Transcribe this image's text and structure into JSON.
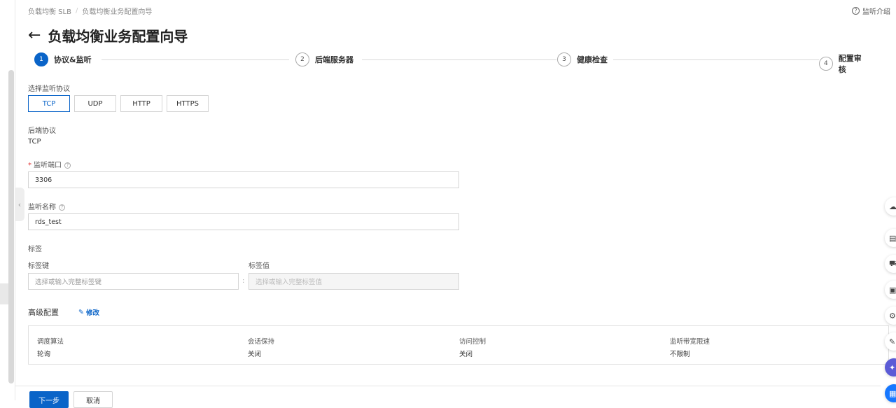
{
  "breadcrumb": {
    "root": "负载均衡 SLB",
    "separator": "/",
    "current": "负载均衡业务配置向导"
  },
  "help": {
    "label": "监听介绍"
  },
  "title": "负载均衡业务配置向导",
  "steps": [
    {
      "num": "1",
      "label": "协议&监听",
      "active": true
    },
    {
      "num": "2",
      "label": "后端服务器",
      "active": false
    },
    {
      "num": "3",
      "label": "健康检查",
      "active": false
    },
    {
      "num": "4",
      "label": "配置审核",
      "active": false
    }
  ],
  "protocol": {
    "label": "选择监听协议",
    "options": [
      "TCP",
      "UDP",
      "HTTP",
      "HTTPS"
    ],
    "selected": "TCP"
  },
  "backend_protocol": {
    "label": "后端协议",
    "value": "TCP"
  },
  "listen_port": {
    "label": "监听端口",
    "value": "3306"
  },
  "listen_name": {
    "label": "监听名称",
    "value": "rds_test"
  },
  "tags": {
    "label": "标签",
    "key_label": "标签键",
    "value_label": "标签值",
    "key_placeholder": "选择或输入完整标签键",
    "value_placeholder": "选择或输入完整标签值",
    "separator": ":"
  },
  "advanced": {
    "title": "高级配置",
    "edit_label": "修改",
    "items": [
      {
        "key": "调度算法",
        "value": "轮询"
      },
      {
        "key": "会话保持",
        "value": "关闭"
      },
      {
        "key": "访问控制",
        "value": "关闭"
      },
      {
        "key": "监听带宽限速",
        "value": "不限制"
      }
    ]
  },
  "footer": {
    "next_label": "下一步",
    "cancel_label": "取消"
  },
  "colors": {
    "primary": "#0a64c8",
    "required": "#e23c3c"
  },
  "float_icons": [
    "cloud-icon",
    "document-icon",
    "cart-icon",
    "monitor-icon",
    "settings-icon",
    "edit-icon",
    "ai-assistant-icon",
    "apps-icon"
  ]
}
